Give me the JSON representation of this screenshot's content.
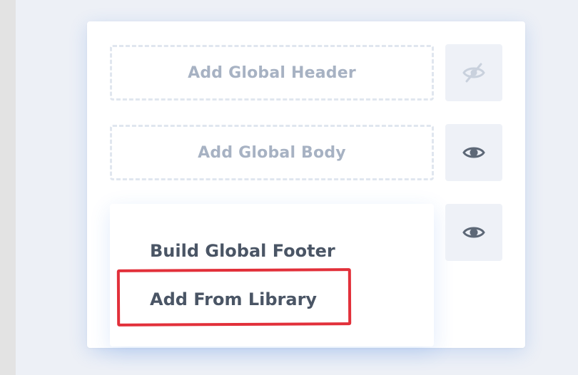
{
  "layout_builder": {
    "header_slot": {
      "label": "Add Global Header",
      "visibility_icon": "eye-slash-icon"
    },
    "body_slot": {
      "label": "Add Global Body",
      "visibility_icon": "eye-icon"
    },
    "footer_slot": {
      "visibility_icon": "eye-icon",
      "menu": [
        {
          "label": "Build Global Footer"
        },
        {
          "label": "Add From Library",
          "highlighted": true
        }
      ]
    }
  },
  "colors": {
    "accent_highlight": "#e2303a",
    "slot_text": "#a7b2c3",
    "menu_text": "#4a5565",
    "eye_icon": "#5d6877"
  }
}
